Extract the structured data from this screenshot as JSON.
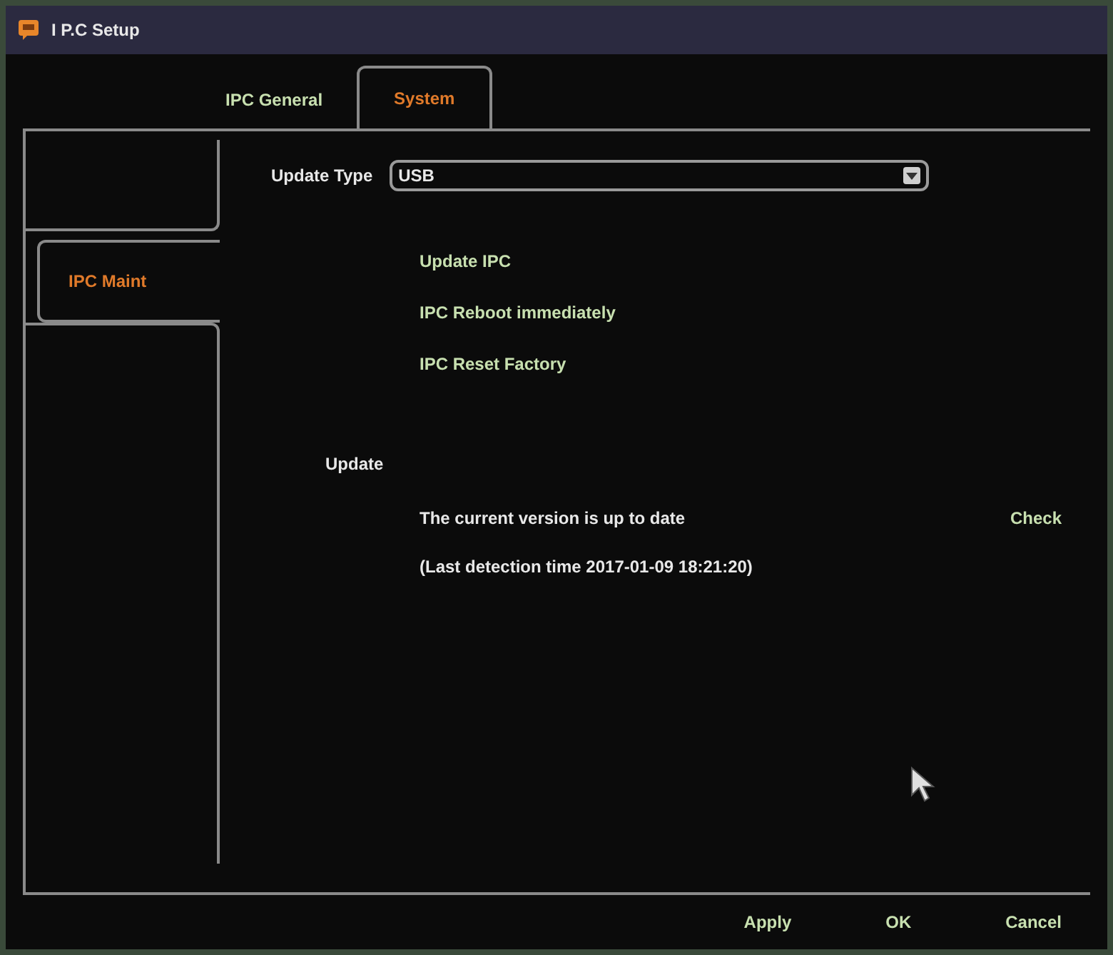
{
  "window": {
    "title": "I P.C Setup"
  },
  "tabs": [
    {
      "label": "IPC General",
      "selected": false
    },
    {
      "label": "System",
      "selected": true
    }
  ],
  "side_tabs": [
    {
      "label": "IPC Maint",
      "selected": true
    }
  ],
  "update_type": {
    "label": "Update Type",
    "value": "USB"
  },
  "actions": [
    "Update IPC",
    "IPC Reboot immediately",
    "IPC Reset Factory"
  ],
  "update": {
    "label": "Update",
    "status": "The current version is up to date",
    "last_detection": "(Last detection time 2017-01-09 18:21:20)",
    "check_button": "Check"
  },
  "buttons": [
    "Apply",
    "OK",
    "Cancel"
  ]
}
